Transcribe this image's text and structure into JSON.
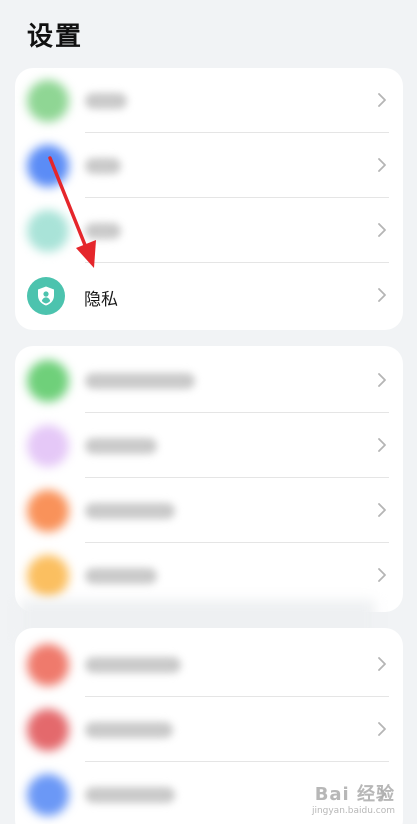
{
  "page": {
    "title": "设置"
  },
  "group1": {
    "rows": [
      {
        "icon": "green-app-icon",
        "color": "#8fd694",
        "blurred": true
      },
      {
        "icon": "blue-app-icon",
        "color": "#5b8cf6",
        "blurred": true
      },
      {
        "icon": "teal-app-icon",
        "color": "#a9e3d8",
        "blurred": true
      },
      {
        "icon": "privacy-shield-icon",
        "color": "#4cc3ae",
        "label": "隐私",
        "blurred": false
      }
    ]
  },
  "group2": {
    "rows": [
      {
        "icon": "green-app-icon",
        "color": "#6fd07a",
        "blurred": true
      },
      {
        "icon": "purple-app-icon",
        "color": "#e5c8f7",
        "blurred": true
      },
      {
        "icon": "orange-app-icon",
        "color": "#f9925a",
        "blurred": true
      },
      {
        "icon": "yellow-app-icon",
        "color": "#fbbf60",
        "blurred": true
      }
    ]
  },
  "group3": {
    "rows": [
      {
        "icon": "red-app-icon",
        "color": "#ef7a6c",
        "blurred": true
      },
      {
        "icon": "red-app-icon",
        "color": "#e4696c",
        "blurred": true
      },
      {
        "icon": "blue-app-icon",
        "color": "#6b98f6",
        "blurred": true
      }
    ]
  },
  "annotation": {
    "color": "#e5262b"
  },
  "watermark": {
    "brand": "Bai 经验",
    "url": "jingyan.baidu.com"
  }
}
